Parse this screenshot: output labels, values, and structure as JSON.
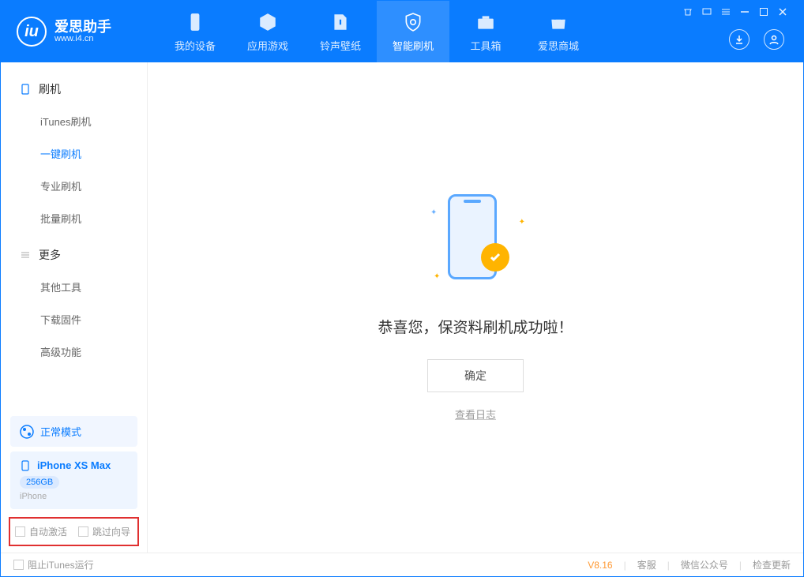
{
  "brand": {
    "title": "爱思助手",
    "subtitle": "www.i4.cn"
  },
  "nav": {
    "tabs": [
      {
        "label": "我的设备"
      },
      {
        "label": "应用游戏"
      },
      {
        "label": "铃声壁纸"
      },
      {
        "label": "智能刷机"
      },
      {
        "label": "工具箱"
      },
      {
        "label": "爱思商城"
      }
    ]
  },
  "sidebar": {
    "section1_title": "刷机",
    "items1": [
      {
        "label": "iTunes刷机"
      },
      {
        "label": "一键刷机"
      },
      {
        "label": "专业刷机"
      },
      {
        "label": "批量刷机"
      }
    ],
    "section2_title": "更多",
    "items2": [
      {
        "label": "其他工具"
      },
      {
        "label": "下载固件"
      },
      {
        "label": "高级功能"
      }
    ],
    "status_label": "正常模式",
    "device_name": "iPhone XS Max",
    "device_storage": "256GB",
    "device_type": "iPhone",
    "chk_auto_activate": "自动激活",
    "chk_skip_guide": "跳过向导"
  },
  "main": {
    "success_msg": "恭喜您，保资料刷机成功啦！",
    "confirm_btn": "确定",
    "view_log": "查看日志"
  },
  "footer": {
    "block_itunes": "阻止iTunes运行",
    "version": "V8.16",
    "links": [
      "客服",
      "微信公众号",
      "检查更新"
    ]
  }
}
